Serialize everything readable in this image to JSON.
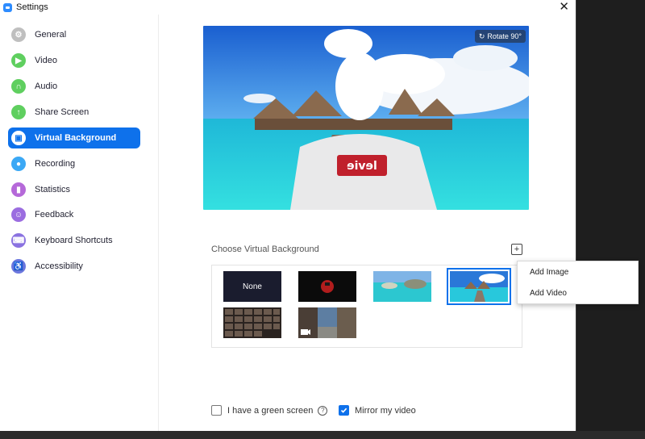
{
  "window": {
    "title": "Settings"
  },
  "sidebar": {
    "items": [
      {
        "label": "General",
        "icon": "gear-icon",
        "color": "#bfbfbf",
        "glyph": "⚙"
      },
      {
        "label": "Video",
        "icon": "video-camera-icon",
        "color": "#5fcf5f",
        "glyph": "▶"
      },
      {
        "label": "Audio",
        "icon": "headphones-icon",
        "color": "#5fcf5f",
        "glyph": "∩"
      },
      {
        "label": "Share Screen",
        "icon": "share-screen-icon",
        "color": "#5fcf5f",
        "glyph": "↑"
      },
      {
        "label": "Virtual Background",
        "icon": "virtual-background-icon",
        "color": "#0e71eb",
        "glyph": "▣",
        "active": true
      },
      {
        "label": "Recording",
        "icon": "recording-icon",
        "color": "#3ba8f5",
        "glyph": "●"
      },
      {
        "label": "Statistics",
        "icon": "statistics-icon",
        "color": "#b569d9",
        "glyph": "▮"
      },
      {
        "label": "Feedback",
        "icon": "feedback-icon",
        "color": "#9b6de0",
        "glyph": "☺"
      },
      {
        "label": "Keyboard Shortcuts",
        "icon": "keyboard-icon",
        "color": "#8a72e0",
        "glyph": "⌨"
      },
      {
        "label": "Accessibility",
        "icon": "accessibility-icon",
        "color": "#6b77de",
        "glyph": "♿"
      }
    ]
  },
  "preview": {
    "rotate_label": "Rotate 90°"
  },
  "backgrounds": {
    "section_label": "Choose Virtual Background",
    "none_label": "None",
    "add_menu": {
      "add_image": "Add Image",
      "add_video": "Add Video"
    }
  },
  "options": {
    "green_screen_label": "I have a green screen",
    "green_screen_checked": false,
    "mirror_label": "Mirror my video",
    "mirror_checked": true
  },
  "colors": {
    "accent": "#0e71eb"
  }
}
